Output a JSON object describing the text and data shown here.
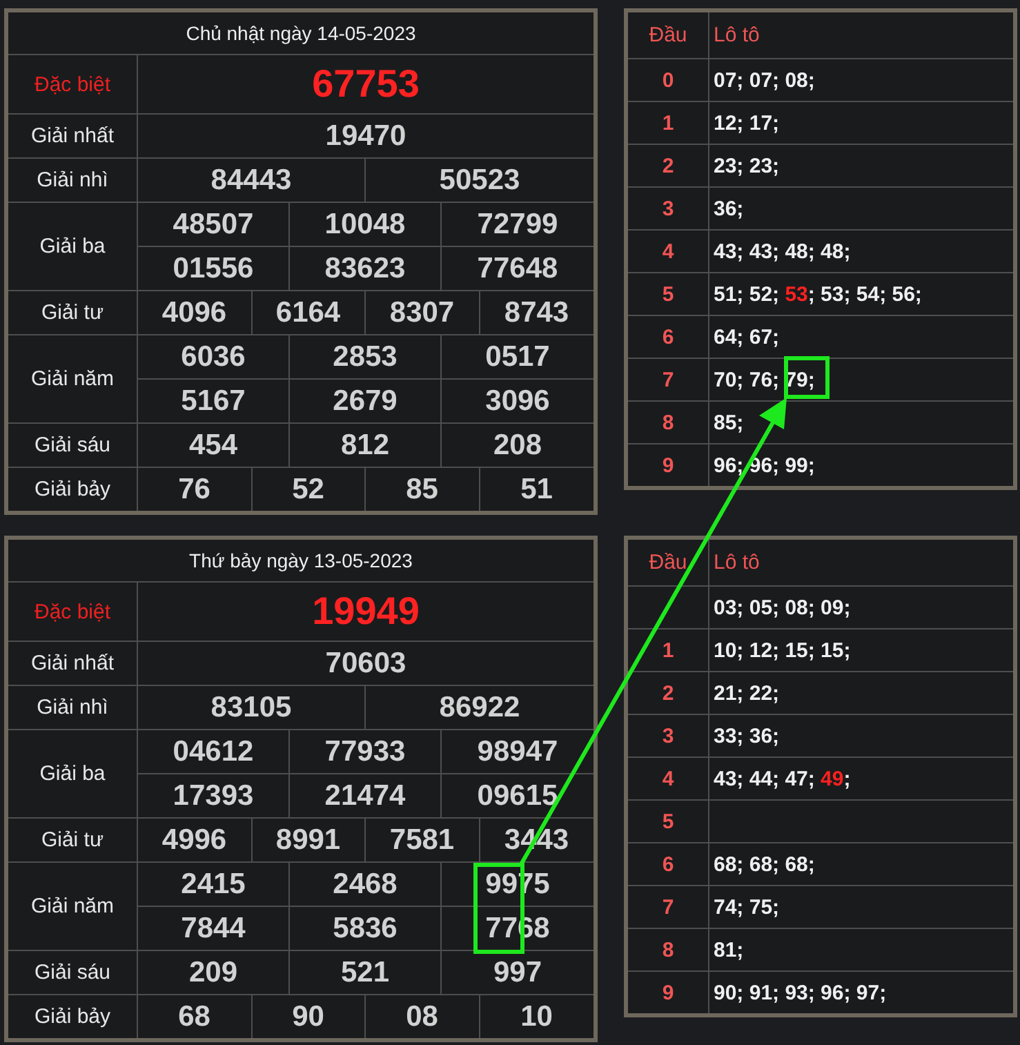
{
  "days": [
    {
      "title": "Chủ nhật ngày 14-05-2023",
      "prizes": [
        {
          "name": "Đặc biệt",
          "kind": "special",
          "rows": [
            [
              "67753"
            ]
          ]
        },
        {
          "name": "Giải nhất",
          "kind": "normal",
          "rows": [
            [
              "19470"
            ]
          ]
        },
        {
          "name": "Giải nhì",
          "kind": "normal",
          "rows": [
            [
              "84443",
              "50523"
            ]
          ]
        },
        {
          "name": "Giải ba",
          "kind": "normal",
          "rows": [
            [
              "48507",
              "10048",
              "72799"
            ],
            [
              "01556",
              "83623",
              "77648"
            ]
          ]
        },
        {
          "name": "Giải tư",
          "kind": "normal",
          "rows": [
            [
              "4096",
              "6164",
              "8307",
              "8743"
            ]
          ]
        },
        {
          "name": "Giải năm",
          "kind": "normal",
          "rows": [
            [
              "6036",
              "2853",
              "0517"
            ],
            [
              "5167",
              "2679",
              "3096"
            ]
          ]
        },
        {
          "name": "Giải sáu",
          "kind": "normal",
          "rows": [
            [
              "454",
              "812",
              "208"
            ]
          ]
        },
        {
          "name": "Giải bảy",
          "kind": "normal",
          "rows": [
            [
              "76",
              "52",
              "85",
              "51"
            ]
          ]
        }
      ],
      "loto": {
        "head_label": "Đầu",
        "numbers_label": "Lô tô",
        "rows": [
          {
            "head": "0",
            "segments": [
              {
                "text": "07; 07; 08;",
                "special": false
              }
            ]
          },
          {
            "head": "1",
            "segments": [
              {
                "text": "12; 17;",
                "special": false
              }
            ]
          },
          {
            "head": "2",
            "segments": [
              {
                "text": "23; 23;",
                "special": false
              }
            ]
          },
          {
            "head": "3",
            "segments": [
              {
                "text": "36;",
                "special": false
              }
            ]
          },
          {
            "head": "4",
            "segments": [
              {
                "text": "43; 43; 48; 48;",
                "special": false
              }
            ]
          },
          {
            "head": "5",
            "segments": [
              {
                "text": "51; 52; ",
                "special": false
              },
              {
                "text": "53",
                "special": true
              },
              {
                "text": "; 53; 54; 56;",
                "special": false
              }
            ]
          },
          {
            "head": "6",
            "segments": [
              {
                "text": "64; 67;",
                "special": false
              }
            ]
          },
          {
            "head": "7",
            "segments": [
              {
                "text": "70; 76; 79;",
                "special": false
              }
            ]
          },
          {
            "head": "8",
            "segments": [
              {
                "text": "85;",
                "special": false
              }
            ]
          },
          {
            "head": "9",
            "segments": [
              {
                "text": "96; 96; 99;",
                "special": false
              }
            ]
          }
        ]
      }
    },
    {
      "title": "Thứ bảy ngày 13-05-2023",
      "prizes": [
        {
          "name": "Đặc biệt",
          "kind": "special",
          "rows": [
            [
              "19949"
            ]
          ]
        },
        {
          "name": "Giải nhất",
          "kind": "normal",
          "rows": [
            [
              "70603"
            ]
          ]
        },
        {
          "name": "Giải nhì",
          "kind": "normal",
          "rows": [
            [
              "83105",
              "86922"
            ]
          ]
        },
        {
          "name": "Giải ba",
          "kind": "normal",
          "rows": [
            [
              "04612",
              "77933",
              "98947"
            ],
            [
              "17393",
              "21474",
              "09615"
            ]
          ]
        },
        {
          "name": "Giải tư",
          "kind": "normal",
          "rows": [
            [
              "4996",
              "8991",
              "7581",
              "3443"
            ]
          ]
        },
        {
          "name": "Giải năm",
          "kind": "normal",
          "rows": [
            [
              "2415",
              "2468",
              "9975"
            ],
            [
              "7844",
              "5836",
              "7768"
            ]
          ]
        },
        {
          "name": "Giải sáu",
          "kind": "normal",
          "rows": [
            [
              "209",
              "521",
              "997"
            ]
          ]
        },
        {
          "name": "Giải bảy",
          "kind": "normal",
          "rows": [
            [
              "68",
              "90",
              "08",
              "10"
            ]
          ]
        }
      ],
      "loto": {
        "head_label": "Đầu",
        "numbers_label": "Lô tô",
        "rows": [
          {
            "segments": [
              {
                "text": "03; 05; 08; 09;",
                "special": false
              }
            ]
          },
          {
            "head": "1",
            "segments": [
              {
                "text": "10; 12; 15; 15;",
                "special": false
              }
            ]
          },
          {
            "head": "2",
            "segments": [
              {
                "text": "21; 22;",
                "special": false
              }
            ]
          },
          {
            "head": "3",
            "segments": [
              {
                "text": "33; 36;",
                "special": false
              }
            ]
          },
          {
            "head": "4",
            "segments": [
              {
                "text": "43; 44; 47; ",
                "special": false
              },
              {
                "text": "49",
                "special": true
              },
              {
                "text": ";",
                "special": false
              }
            ]
          },
          {
            "head": "5"
          },
          {
            "head": "6",
            "segments": [
              {
                "text": "68; 68; 68;",
                "special": false
              }
            ]
          },
          {
            "head": "7",
            "segments": [
              {
                "text": "74; 75;",
                "special": false
              }
            ]
          },
          {
            "head": "8",
            "segments": [
              {
                "text": "81;",
                "special": false
              }
            ]
          },
          {
            "head": "9",
            "segments": [
              {
                "text": "90; 91; 93; 96; 97;",
                "special": false
              }
            ]
          }
        ]
      }
    }
  ],
  "annotation": {
    "kind": "arrow-link"
  }
}
